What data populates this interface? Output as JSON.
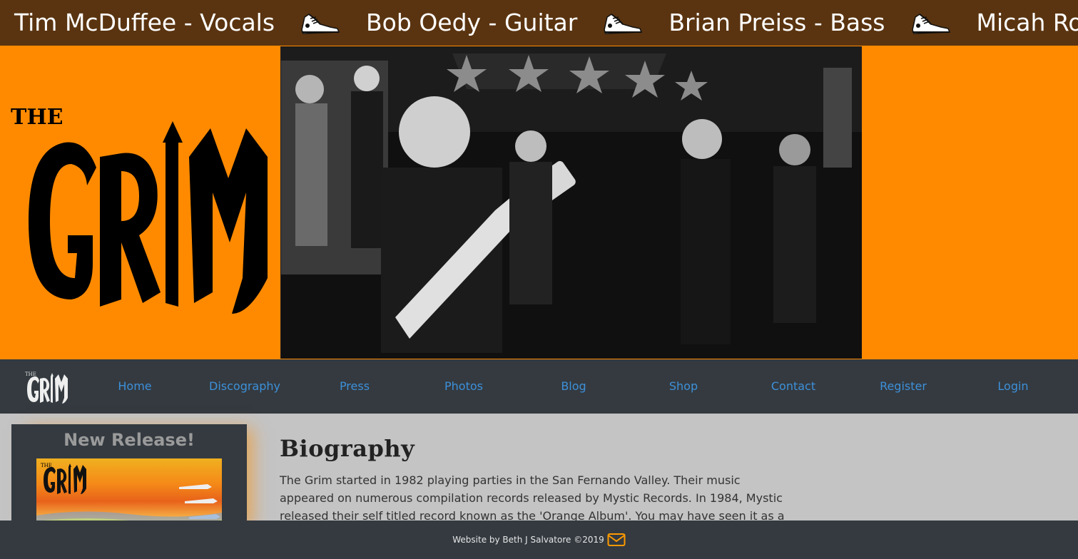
{
  "ticker": {
    "items": [
      "Tim McDuffee - Vocals",
      "Bob Oedy - Guitar",
      "Brian Preiss - Bass",
      "Micah Rosellini - Drums"
    ],
    "separator_icon": "sneaker-icon"
  },
  "banner": {
    "logo_text": "THE GRIM",
    "background_color": "#ff8a00"
  },
  "nav": {
    "logo_icon": "grim-logo-icon",
    "links": [
      "Home",
      "Discography",
      "Press",
      "Photos",
      "Blog",
      "Shop",
      "Contact",
      "Register",
      "Login"
    ],
    "link_color": "#3d90d9"
  },
  "sidebar": {
    "card_title": "New Release!"
  },
  "main": {
    "heading": "Biography",
    "paragraph": "The Grim started in 1982 playing parties in the San Fernando Valley. Their music appeared on numerous compilation records released by Mystic Records. In 1984, Mystic released their self titled record known as the 'Orange Album'. You may have seen it as a backdrop in the movie"
  },
  "footer": {
    "credit": "Website by Beth J Salvatore ©2019",
    "mail_icon": "envelope-icon",
    "accent_color": "#ff9a00"
  }
}
